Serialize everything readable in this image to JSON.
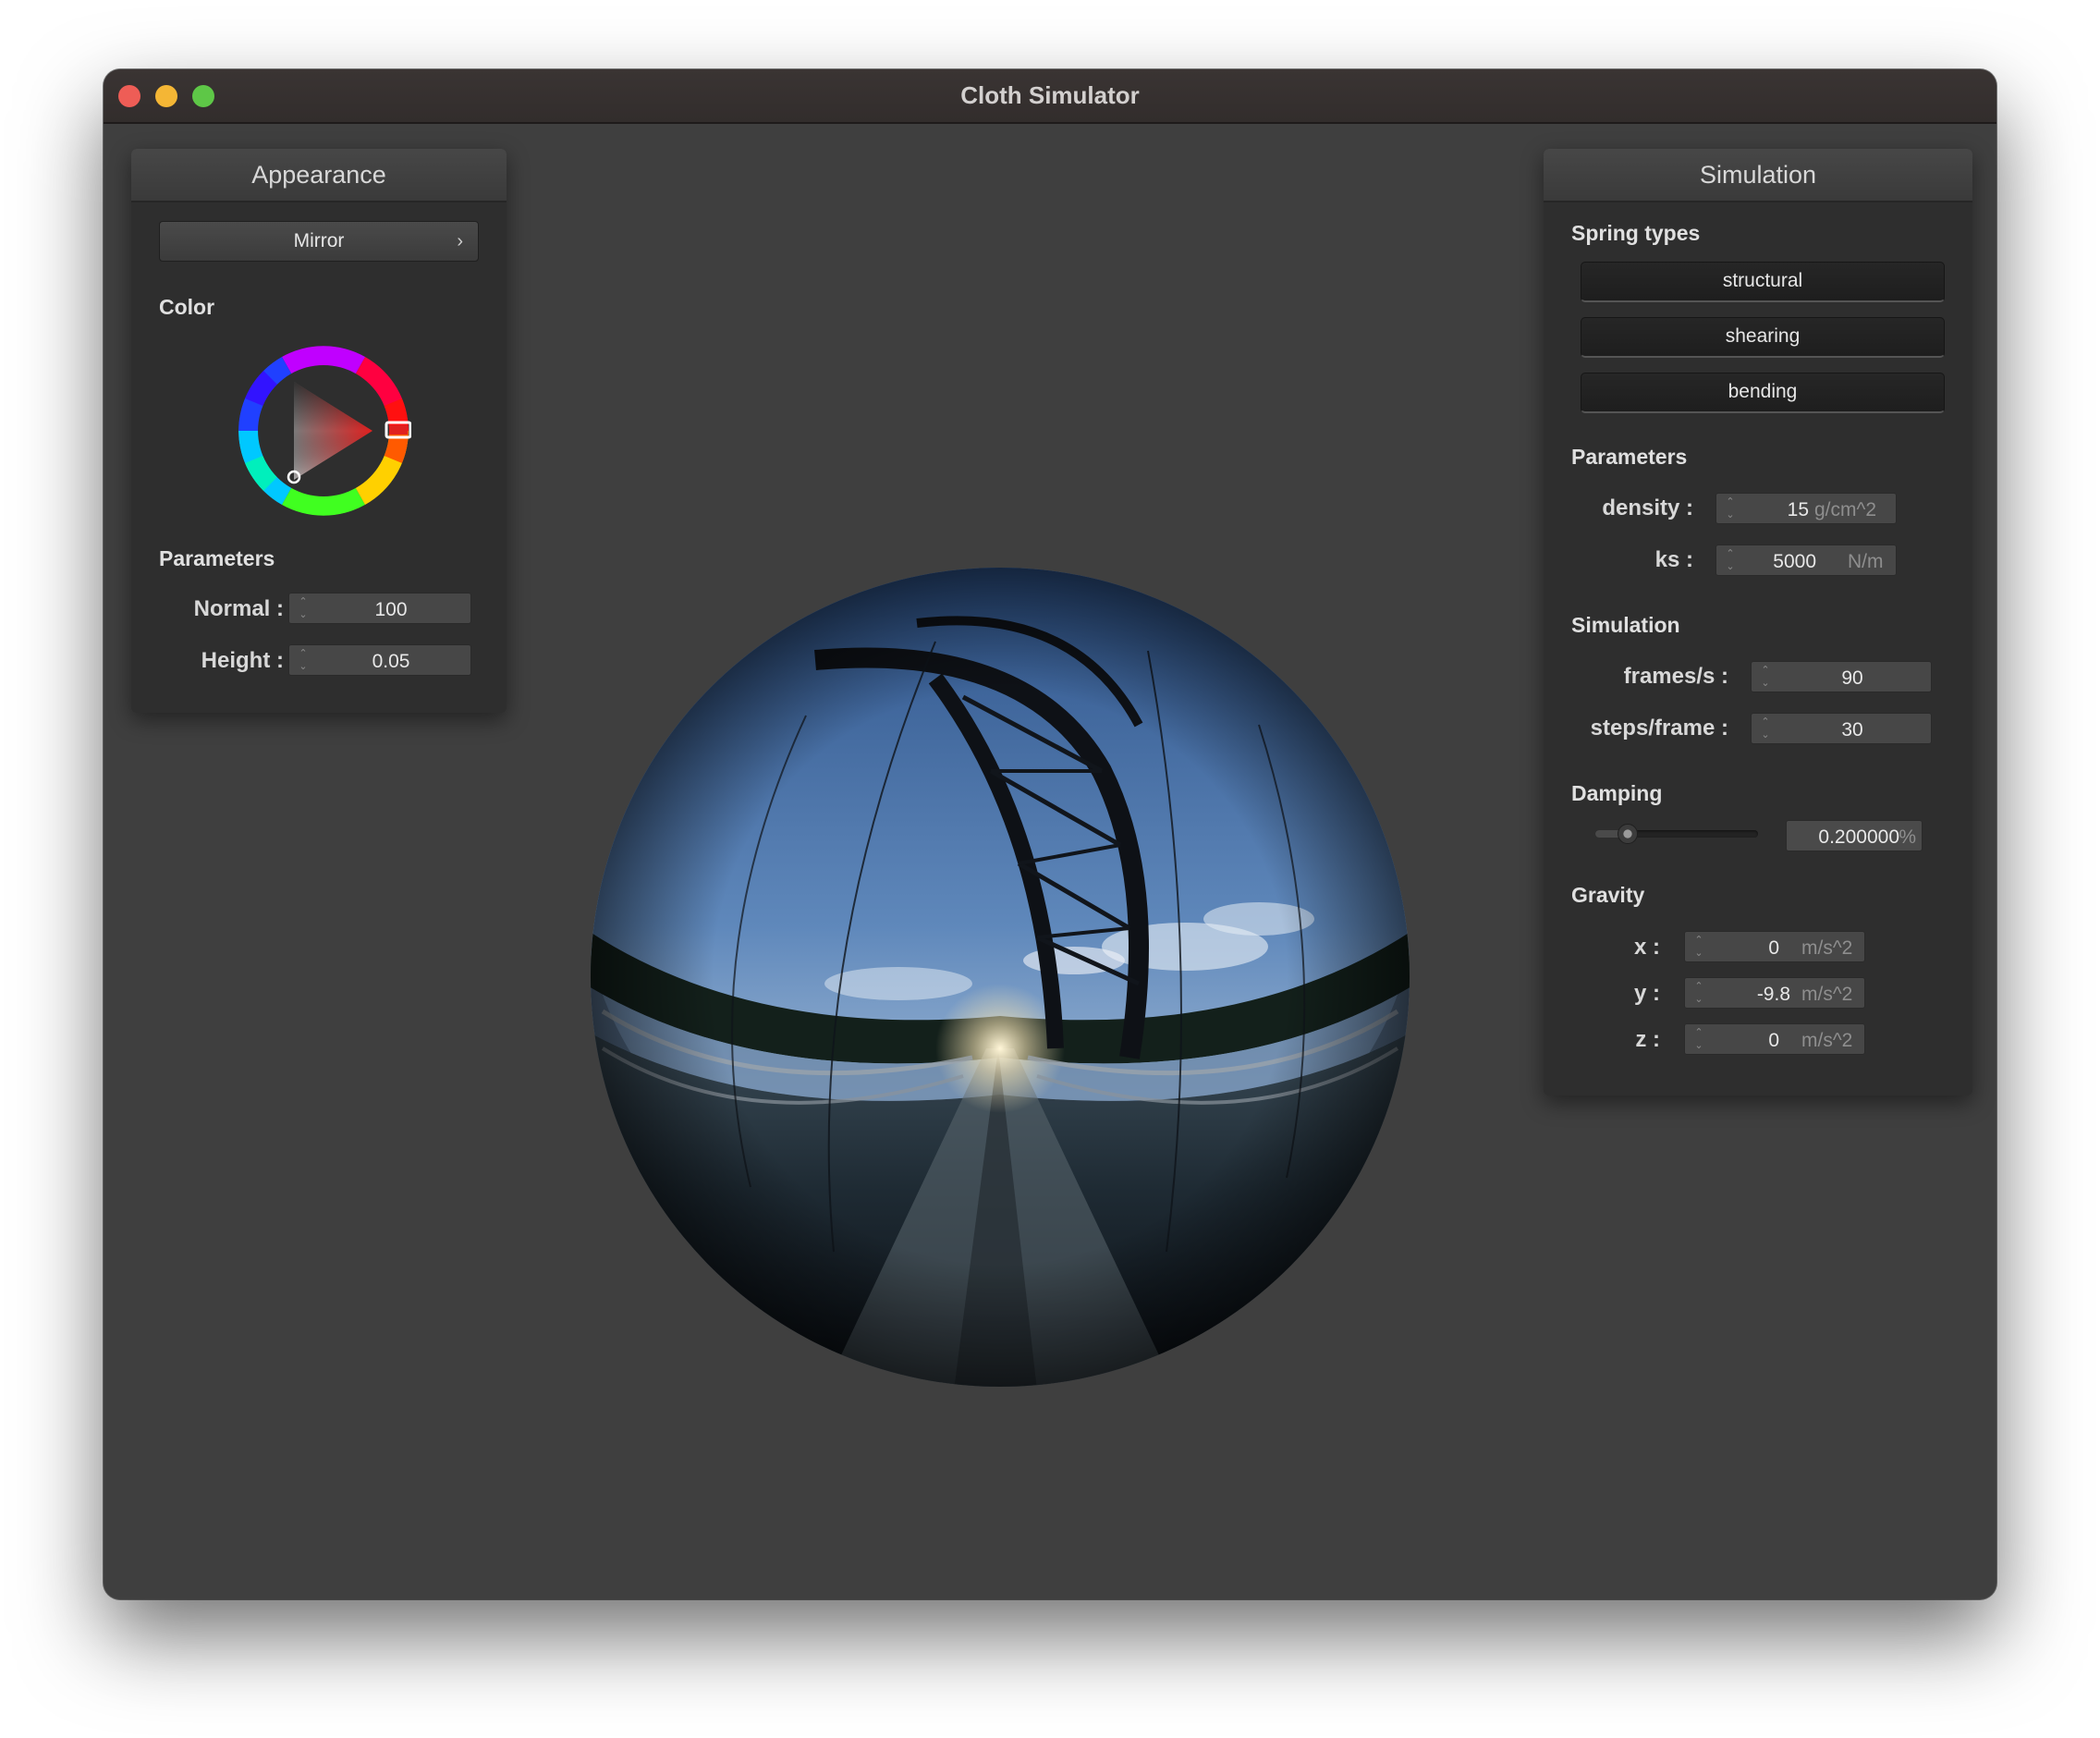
{
  "window": {
    "title": "Cloth Simulator"
  },
  "appearance": {
    "title": "Appearance",
    "shader_select": "Mirror",
    "color_label": "Color",
    "parameters_label": "Parameters",
    "normal_label": "Normal :",
    "normal_value": "100",
    "height_label": "Height :",
    "height_value": "0.05"
  },
  "simulation": {
    "title": "Simulation",
    "spring_types_label": "Spring types",
    "springs": [
      "structural",
      "shearing",
      "bending"
    ],
    "parameters_label": "Parameters",
    "density_label": "density :",
    "density_value": "15",
    "density_unit": "g/cm^2",
    "ks_label": "ks :",
    "ks_value": "5000",
    "ks_unit": "N/m",
    "simulation_label": "Simulation",
    "fps_label": "frames/s :",
    "fps_value": "90",
    "steps_label": "steps/frame :",
    "steps_value": "30",
    "damping_label": "Damping",
    "damping_value": "0.200000",
    "damping_unit": "%",
    "damping_level": 0.2,
    "gravity_label": "Gravity",
    "gx_label": "x :",
    "gx_value": "0",
    "gy_label": "y :",
    "gy_value": "-9.8",
    "gz_label": "z :",
    "gz_value": "0",
    "gravity_unit": "m/s^2"
  },
  "colors": {
    "selected_color": "#e0201f",
    "window_bg": "#3f3f3f"
  }
}
